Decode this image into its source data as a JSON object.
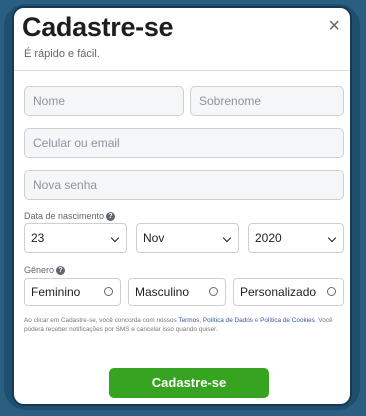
{
  "header": {
    "title": "Cadastre-se",
    "subtitle": "É rápido e fácil.",
    "close_glyph": "×"
  },
  "form": {
    "first_name_placeholder": "Nome",
    "last_name_placeholder": "Sobrenome",
    "contact_placeholder": "Celular ou email",
    "password_placeholder": "Nova senha",
    "birth_label": "Data de nascimento",
    "birth_day": "23",
    "birth_month": "Nov",
    "birth_year": "2020",
    "gender_label": "Gênero",
    "gender_options": [
      "Feminino",
      "Masculino",
      "Personalizado"
    ]
  },
  "terms": {
    "prefix": "Ao clicar em Cadastre-se, você concorda com nossos ",
    "link_terms": "Termos",
    "sep1": ", ",
    "link_data_policy": "Política de Dados",
    "mid": " e ",
    "link_cookie_policy": "Política de Cookies",
    "suffix": ". Você poderá receber notificações por SMS e cancelar isso quando quiser."
  },
  "submit_label": "Cadastre-se",
  "colors": {
    "accent_green": "#36a420",
    "link_blue": "#385898"
  },
  "icons": {
    "close": "close-icon",
    "help": "help-icon",
    "chevron": "chevron-down-icon",
    "radio": "radio-icon"
  }
}
